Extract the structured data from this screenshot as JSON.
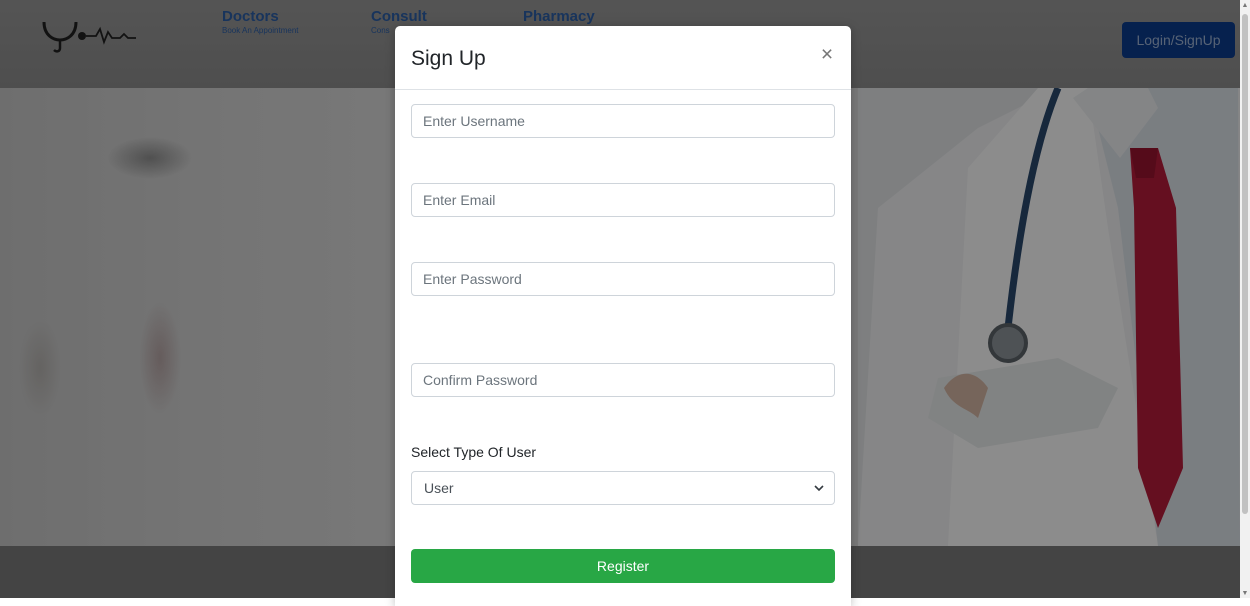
{
  "navbar": {
    "logo": "stethoscope-heartbeat-logo",
    "items": [
      {
        "title": "Doctors",
        "subtitle": "Book An Appointment"
      },
      {
        "title": "Consult",
        "subtitle": "Cons"
      },
      {
        "title": "Pharmacy",
        "subtitle": ""
      }
    ],
    "login_label": "Login/SignUp"
  },
  "modal": {
    "title": "Sign Up",
    "close_icon": "close-icon",
    "fields": {
      "username_placeholder": "Enter Username",
      "email_placeholder": "Enter Email",
      "password_placeholder": "Enter Password",
      "confirm_password_placeholder": "Confirm Password"
    },
    "user_type": {
      "label": "Select Type Of User",
      "selected": "User"
    },
    "register_label": "Register"
  },
  "colors": {
    "register": "#28a745",
    "nav_link": "#2c5fa8",
    "login_button": "#0b3d8f"
  }
}
